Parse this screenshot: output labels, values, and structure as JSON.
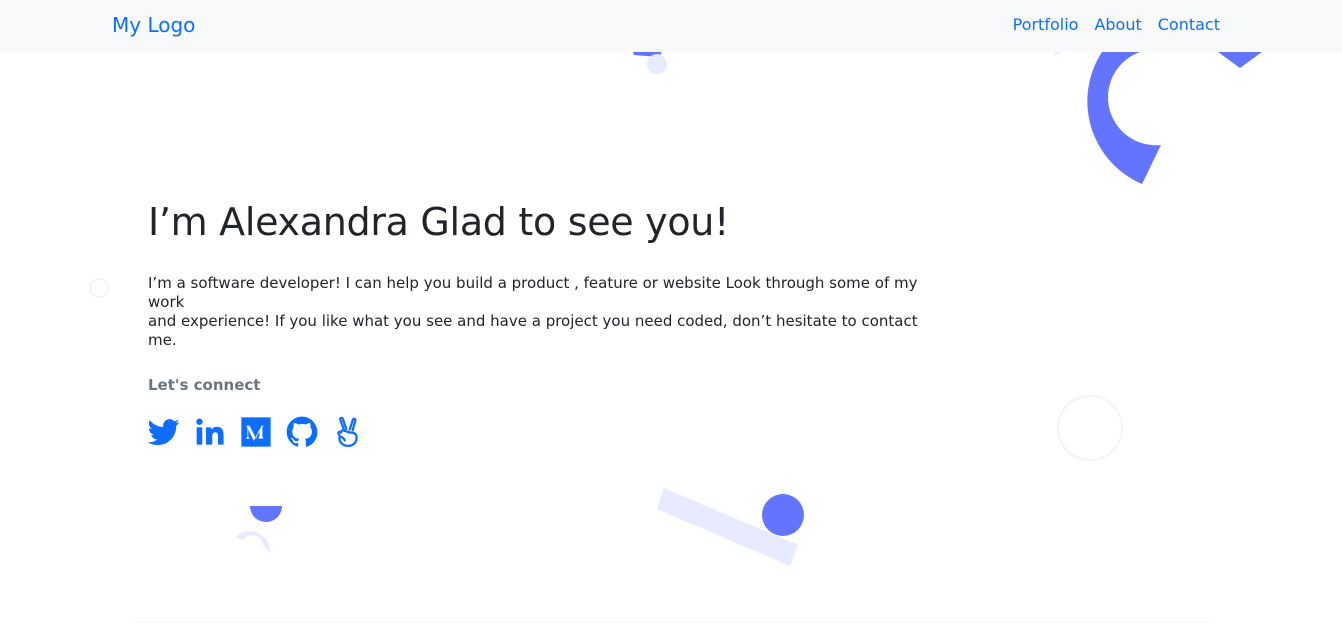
{
  "nav": {
    "logo": "My Logo",
    "links": [
      "Portfolio",
      "About",
      "Contact"
    ]
  },
  "hero": {
    "heading": "I’m Alexandra Glad to see you!",
    "description_line1": "I’m a software developer! I can help you build a product , feature or website Look through some of my work",
    "description_line2": "and experience! If you like what you see and have a project you need coded, don’t hesitate to contact me.",
    "connect_label": "Let's connect"
  },
  "socials": [
    "twitter-icon",
    "linkedin-icon",
    "medium-icon",
    "github-icon",
    "angellist-icon"
  ],
  "colors": {
    "accent": "#0d6efd",
    "shape_primary": "#6374ff",
    "shape_light": "#e8eaff",
    "navbar_bg": "#f8f9fa",
    "text": "#212529",
    "muted": "#6c757d"
  }
}
